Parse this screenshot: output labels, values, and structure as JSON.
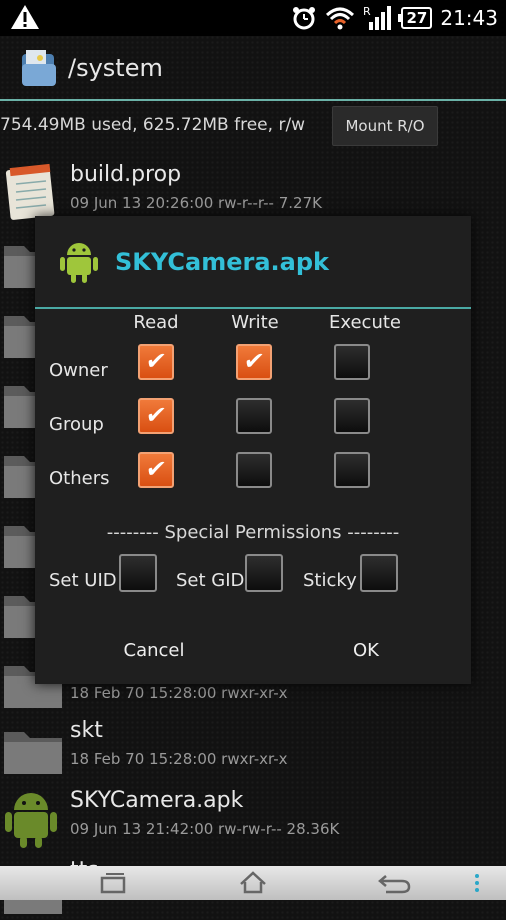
{
  "status_bar": {
    "time": "21:43",
    "battery": "27",
    "signal_letter": "R",
    "icons": [
      "warning-icon",
      "alarm-icon",
      "wifi-icon",
      "signal-icon",
      "battery-icon"
    ]
  },
  "header": {
    "path": "/system"
  },
  "storage": {
    "usage": "754.49MB used, 625.72MB free, r/w",
    "mount_button": "Mount R/O"
  },
  "files": [
    {
      "name": "build.prop",
      "meta": "09 Jun 13 20:26:00  rw-r--r--  7.27K",
      "icon": "text-file-icon"
    },
    {
      "name": "",
      "meta": "",
      "icon": "folder-icon"
    },
    {
      "name": "",
      "meta": "",
      "icon": "folder-icon"
    },
    {
      "name": "",
      "meta": "",
      "icon": "folder-icon"
    },
    {
      "name": "",
      "meta": "",
      "icon": "folder-icon"
    },
    {
      "name": "",
      "meta": "",
      "icon": "folder-icon"
    },
    {
      "name": "",
      "meta": "",
      "icon": "folder-icon"
    },
    {
      "name": "",
      "meta": "18 Feb 70 15:28:00  rwxr-xr-x",
      "icon": "folder-icon"
    },
    {
      "name": "skt",
      "meta": "18 Feb 70 15:28:00  rwxr-xr-x",
      "icon": "folder-icon"
    },
    {
      "name": "SKYCamera.apk",
      "meta": "09 Jun 13 21:42:00  rw-rw-r--  28.36K",
      "icon": "android-icon"
    },
    {
      "name": "tts",
      "meta": "",
      "icon": "folder-icon"
    }
  ],
  "dialog": {
    "title": "SKYCamera.apk",
    "columns": [
      "Read",
      "Write",
      "Execute"
    ],
    "rows": [
      {
        "label": "Owner",
        "read": true,
        "write": true,
        "execute": false
      },
      {
        "label": "Group",
        "read": true,
        "write": false,
        "execute": false
      },
      {
        "label": "Others",
        "read": true,
        "write": false,
        "execute": false
      }
    ],
    "special_heading": "-------- Special Permissions --------",
    "special": [
      {
        "label": "Set UID",
        "checked": false
      },
      {
        "label": "Set GID",
        "checked": false
      },
      {
        "label": "Sticky",
        "checked": false
      }
    ],
    "cancel_label": "Cancel",
    "ok_label": "OK"
  },
  "colors": {
    "accent": "#33c0d8",
    "checkbox_on": "#e8622a",
    "rule": "#4aa9a4"
  }
}
